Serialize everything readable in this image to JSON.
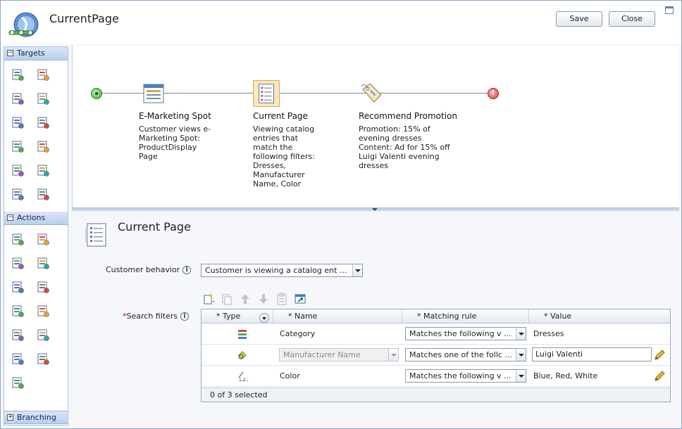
{
  "header": {
    "title": "CurrentPage",
    "save_label": "Save",
    "close_label": "Close"
  },
  "palette": {
    "sections": [
      {
        "label": "Targets",
        "expanded": true,
        "collapse_glyph": "−"
      },
      {
        "label": "Actions",
        "expanded": true,
        "collapse_glyph": "−"
      },
      {
        "label": "Branching",
        "expanded": false,
        "collapse_glyph": "+"
      }
    ],
    "targets": [
      "customer-segment-icon",
      "shopping-cart-icon",
      "catalog-browsing-icon",
      "current-page-icon",
      "catalog-entries-icon",
      "purchase-history-icon",
      "category-icon",
      "shopping-bag-icon",
      "social-commerce-icon",
      "calendar-icon",
      "registration-icon",
      "search-criteria-icon"
    ],
    "actions": [
      "display-content-icon",
      "display-entry-icon",
      "display-category-icon",
      "display-list-icon",
      "recommend-promotion-icon",
      "add-to-cart-icon",
      "send-message-icon",
      "edit-segment-icon",
      "add-segment-icon",
      "note-icon",
      "web-activity-icon",
      "display-ad-icon",
      "custom-action-icon"
    ]
  },
  "flow": {
    "nodes": [
      {
        "title": "E-Marketing Spot",
        "description": [
          "Customer views e-",
          "Marketing Spot:",
          "ProductDisplay",
          "Page"
        ],
        "icon": "e-marketing-spot-icon"
      },
      {
        "title": "Current Page",
        "description": [
          "Viewing catalog",
          "entries that",
          "match the",
          "following filters:",
          "Dresses,",
          "Manufacturer",
          "Name, Color"
        ],
        "icon": "current-page-icon",
        "selected": true
      },
      {
        "title": "Recommend Promotion",
        "description": [
          "Promotion: 15% of",
          "evening dresses",
          "Content: Ad for 15% off",
          "Luigi Valenti evening",
          "dresses"
        ],
        "icon": "promotion-tag-icon"
      }
    ],
    "end_glyph": "!"
  },
  "properties": {
    "title": "Current Page",
    "customer_behavior_label": "Customer behavior",
    "customer_behavior_value": "Customer is viewing a catalog ent ...",
    "search_filters_required": "*",
    "search_filters_label": "Search filters",
    "info_glyph": "i",
    "grid": {
      "columns": [
        "* Type",
        "* Name",
        "* Matching rule",
        "* Value"
      ],
      "rows": [
        {
          "type_icon": "category-type-icon",
          "name": "Category",
          "name_editable": false,
          "matching_rule": "Matches the following v ...",
          "value": "Dresses",
          "value_editable": false,
          "has_pencil": false
        },
        {
          "type_icon": "attribute-type-icon",
          "name": "Manufacturer Name",
          "name_editable": true,
          "matching_rule": "Matches one of the follc ...",
          "value": "Luigi Valenti",
          "value_editable": true,
          "has_pencil": true
        },
        {
          "type_icon": "numbered-list-type-icon",
          "name": "Color",
          "name_editable": false,
          "matching_rule": "Matches the following v ...",
          "value": "Blue, Red, White",
          "value_editable": false,
          "has_pencil": true
        }
      ],
      "footer": "0 of 3 selected"
    }
  }
}
